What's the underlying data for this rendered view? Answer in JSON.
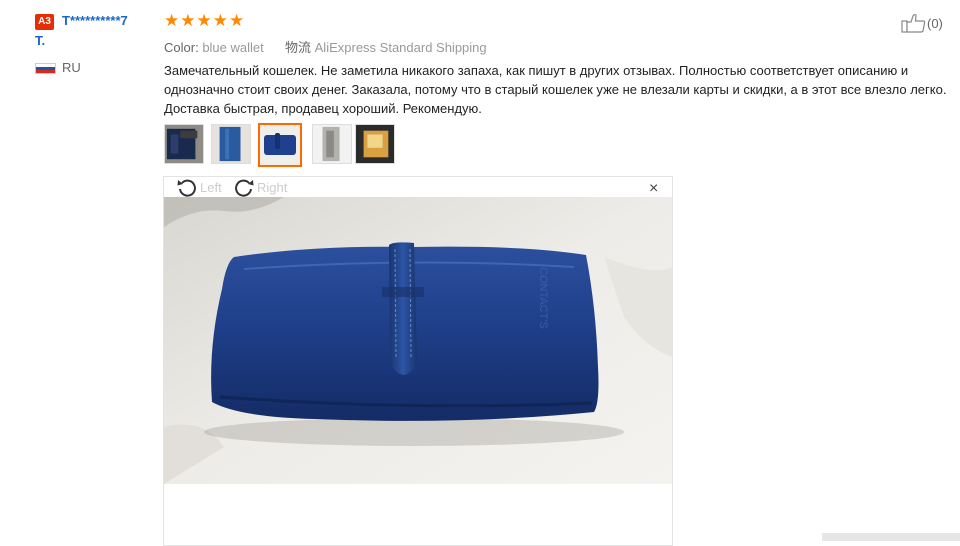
{
  "reviewer": {
    "badge": "A3",
    "name_line1": "T**********7",
    "name_line2": "T.",
    "country": "RU"
  },
  "rating": {
    "stars": 5,
    "max": 5,
    "star_glyph": "★"
  },
  "meta": {
    "color_label": "Color:",
    "color_value": "blue wallet",
    "shipping_label": "物流",
    "shipping_value": "AliExpress Standard Shipping"
  },
  "review_text": "Замечательный кошелек. Не заметила никакого запаха, как пишут в других отзывах. Полностью соответствует описанию и однозначно стоит своих денег. Заказала, потому что в старый кошелек уже не влезали карты и скидки, а в этот все влезло легко. Доставка быстрая, продавец хороший. Рекомендую.",
  "helpful": {
    "count": "(0)"
  },
  "thumbnails": [
    {
      "name": "photo-1",
      "active": false
    },
    {
      "name": "photo-2",
      "active": false
    },
    {
      "name": "photo-3",
      "active": true
    },
    {
      "name": "photo-4",
      "active": false
    },
    {
      "name": "photo-5",
      "active": false
    }
  ],
  "viewer": {
    "rotate_left_label": "Left",
    "rotate_right_label": "Right",
    "close_glyph": "×"
  },
  "colors": {
    "star": "#ff8a00",
    "username": "#1a66c8",
    "badge": "#e62e04",
    "active_thumb": "#ff6a00",
    "wallet": "#1f3f8f"
  }
}
